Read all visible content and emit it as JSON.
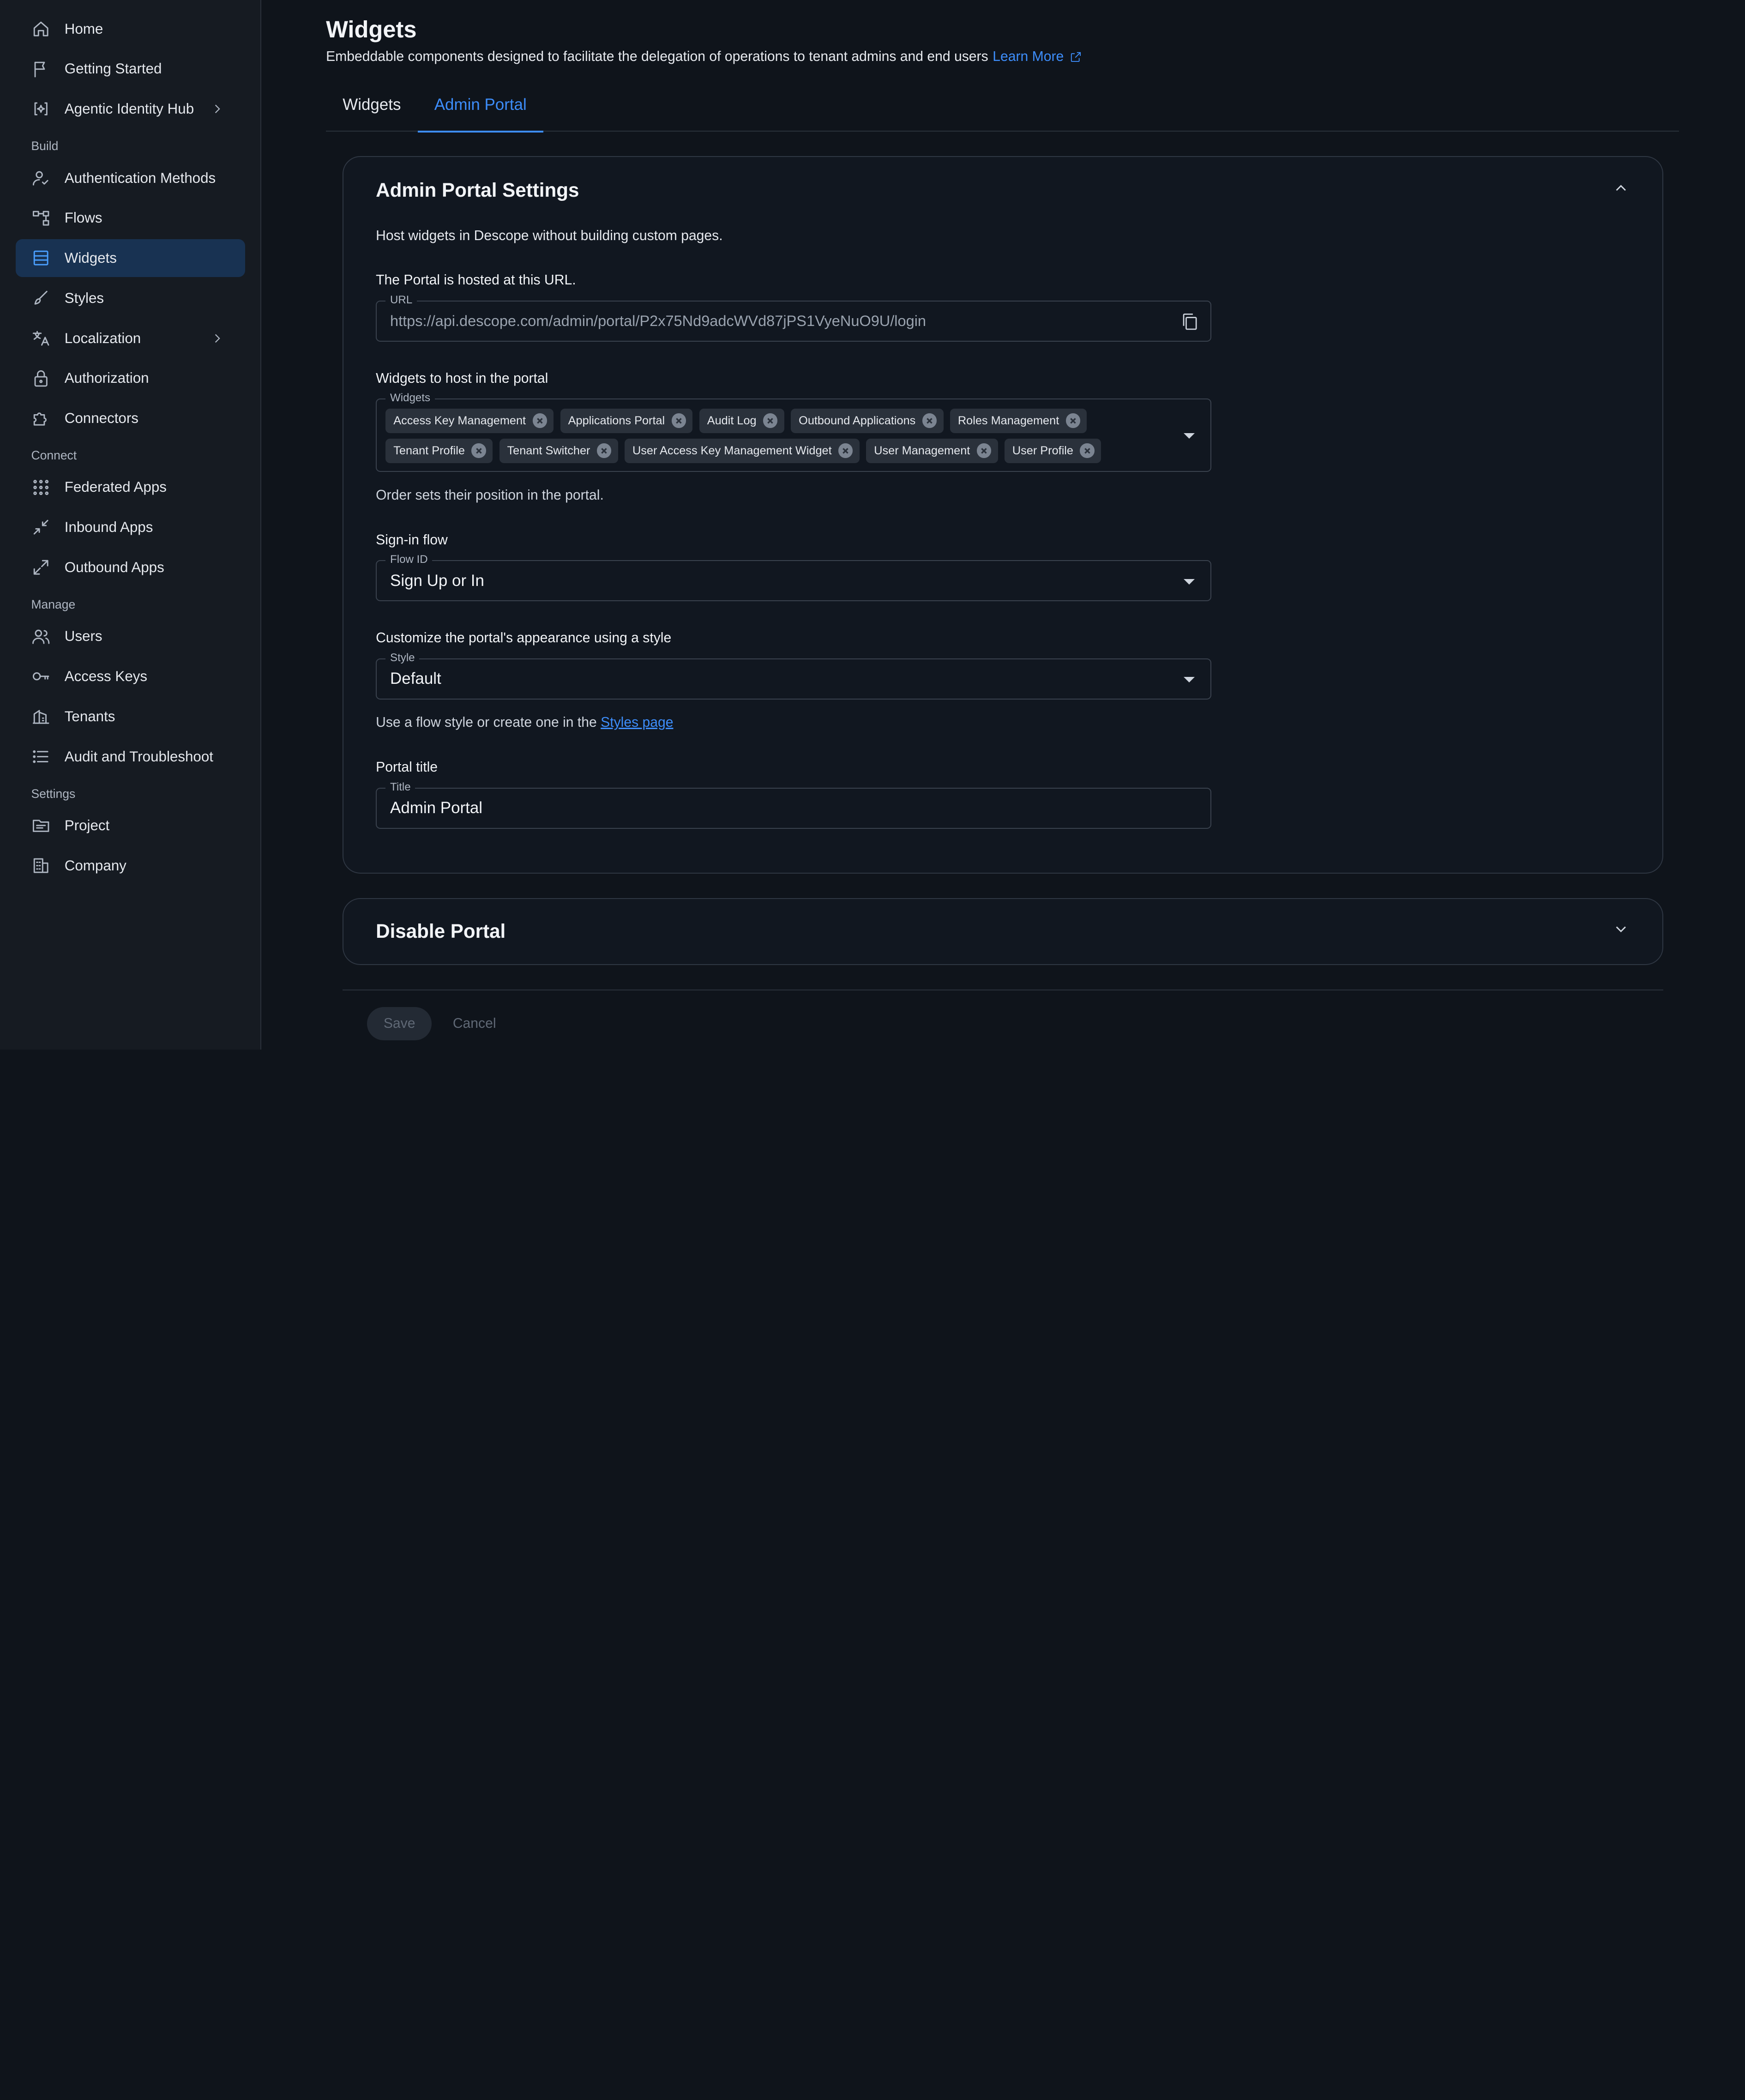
{
  "sidebar": {
    "items": [
      {
        "label": "Home",
        "icon": "home-icon"
      },
      {
        "label": "Getting Started",
        "icon": "flag-icon"
      },
      {
        "label": "Agentic Identity Hub",
        "icon": "agentic-hub-icon",
        "has_submenu": true
      }
    ],
    "build_label": "Build",
    "build_items": [
      {
        "label": "Authentication Methods",
        "icon": "authentication-icon"
      },
      {
        "label": "Flows",
        "icon": "flows-icon"
      },
      {
        "label": "Widgets",
        "icon": "widgets-icon",
        "active": true
      },
      {
        "label": "Styles",
        "icon": "brush-icon"
      },
      {
        "label": "Localization",
        "icon": "translate-icon",
        "has_submenu": true
      },
      {
        "label": "Authorization",
        "icon": "lock-icon"
      },
      {
        "label": "Connectors",
        "icon": "puzzle-icon"
      }
    ],
    "connect_label": "Connect",
    "connect_items": [
      {
        "label": "Federated Apps",
        "icon": "grid-icon"
      },
      {
        "label": "Inbound Apps",
        "icon": "arrows-in-icon"
      },
      {
        "label": "Outbound Apps",
        "icon": "arrows-out-icon"
      }
    ],
    "manage_label": "Manage",
    "manage_items": [
      {
        "label": "Users",
        "icon": "users-icon"
      },
      {
        "label": "Access Keys",
        "icon": "key-icon"
      },
      {
        "label": "Tenants",
        "icon": "buildings-icon"
      },
      {
        "label": "Audit and Troubleshoot",
        "icon": "list-icon"
      }
    ],
    "settings_label": "Settings",
    "settings_items": [
      {
        "label": "Project",
        "icon": "folder-icon"
      },
      {
        "label": "Company",
        "icon": "company-icon"
      }
    ]
  },
  "header": {
    "title": "Widgets",
    "subtitle": "Embeddable components designed to facilitate the delegation of operations to tenant admins and end users",
    "learn_more": "Learn More"
  },
  "tabs": [
    {
      "label": "Widgets",
      "active": false
    },
    {
      "label": "Admin Portal",
      "active": true
    }
  ],
  "settings_card": {
    "title": "Admin Portal Settings",
    "description": "Host widgets in Descope without building custom pages.",
    "url_section_label": "The Portal is hosted at this URL.",
    "url_legend": "URL",
    "url_value": "https://api.descope.com/admin/portal/P2x75Nd9adcWVd87jPS1VyeNuO9U/login",
    "widgets_section_label": "Widgets to host in the portal",
    "widgets_legend": "Widgets",
    "widgets": [
      "Access Key Management",
      "Applications Portal",
      "Audit Log",
      "Outbound Applications",
      "Roles Management",
      "Tenant Profile",
      "Tenant Switcher",
      "User Access Key Management Widget",
      "User Management",
      "User Profile"
    ],
    "widgets_helper": "Order sets their position in the portal.",
    "signin_section_label": "Sign-in flow",
    "flow_legend": "Flow ID",
    "flow_value": "Sign Up or In",
    "style_section_label": "Customize the portal's appearance using a style",
    "style_legend": "Style",
    "style_value": "Default",
    "style_helper_prefix": "Use a flow style or create one in the ",
    "style_helper_link": "Styles page",
    "title_section_label": "Portal title",
    "title_legend": "Title",
    "title_value": "Admin Portal"
  },
  "disable_card": {
    "title": "Disable Portal"
  },
  "footer": {
    "save_label": "Save",
    "cancel_label": "Cancel"
  }
}
